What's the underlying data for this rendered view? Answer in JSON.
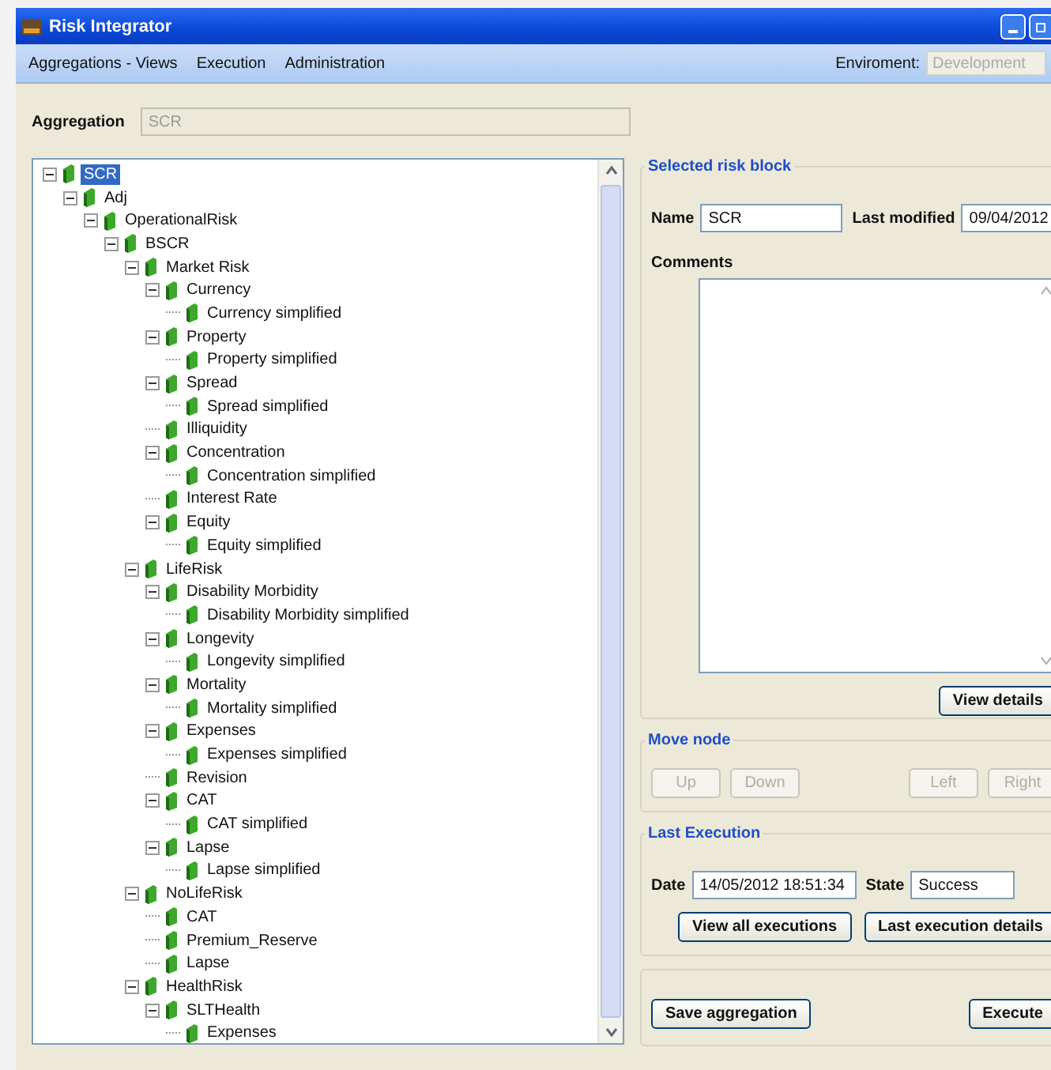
{
  "window": {
    "title": "Risk Integrator"
  },
  "menu": [
    "Aggregations - Views",
    "Execution",
    "Administration"
  ],
  "environment": {
    "label": "Enviroment:",
    "value": "Development",
    "disabled": true
  },
  "aggregation": {
    "label": "Aggregation",
    "value": "SCR",
    "disabled": true
  },
  "tree": [
    {
      "label": "SCR",
      "selected": true,
      "expanded": true,
      "children": [
        {
          "label": "Adj",
          "selected": false,
          "expanded": true,
          "children": [
            {
              "label": "OperationalRisk",
              "selected": false,
              "expanded": true,
              "children": [
                {
                  "label": "BSCR",
                  "selected": false,
                  "expanded": true,
                  "children": [
                    {
                      "label": "Market Risk",
                      "selected": false,
                      "expanded": true,
                      "children": [
                        {
                          "label": "Currency",
                          "selected": false,
                          "expanded": true,
                          "children": [
                            {
                              "label": "Currency simplified",
                              "selected": false
                            }
                          ]
                        },
                        {
                          "label": "Property",
                          "selected": false,
                          "expanded": true,
                          "children": [
                            {
                              "label": "Property simplified",
                              "selected": false
                            }
                          ]
                        },
                        {
                          "label": "Spread",
                          "selected": false,
                          "expanded": true,
                          "children": [
                            {
                              "label": "Spread simplified",
                              "selected": false
                            }
                          ]
                        },
                        {
                          "label": "Illiquidity",
                          "selected": false
                        },
                        {
                          "label": "Concentration",
                          "selected": false,
                          "expanded": true,
                          "children": [
                            {
                              "label": "Concentration simplified",
                              "selected": false
                            }
                          ]
                        },
                        {
                          "label": "Interest Rate",
                          "selected": false
                        },
                        {
                          "label": "Equity",
                          "selected": false,
                          "expanded": true,
                          "children": [
                            {
                              "label": "Equity simplified",
                              "selected": false
                            }
                          ]
                        }
                      ]
                    },
                    {
                      "label": "LifeRisk",
                      "selected": false,
                      "expanded": true,
                      "children": [
                        {
                          "label": "Disability Morbidity",
                          "selected": false,
                          "expanded": true,
                          "children": [
                            {
                              "label": "Disability Morbidity simplified",
                              "selected": false
                            }
                          ]
                        },
                        {
                          "label": "Longevity",
                          "selected": false,
                          "expanded": true,
                          "children": [
                            {
                              "label": "Longevity simplified",
                              "selected": false
                            }
                          ]
                        },
                        {
                          "label": "Mortality",
                          "selected": false,
                          "expanded": true,
                          "children": [
                            {
                              "label": "Mortality simplified",
                              "selected": false
                            }
                          ]
                        },
                        {
                          "label": "Expenses",
                          "selected": false,
                          "expanded": true,
                          "children": [
                            {
                              "label": "Expenses simplified",
                              "selected": false
                            }
                          ]
                        },
                        {
                          "label": "Revision",
                          "selected": false
                        },
                        {
                          "label": "CAT",
                          "selected": false,
                          "expanded": true,
                          "children": [
                            {
                              "label": "CAT simplified",
                              "selected": false
                            }
                          ]
                        },
                        {
                          "label": "Lapse",
                          "selected": false,
                          "expanded": true,
                          "children": [
                            {
                              "label": "Lapse simplified",
                              "selected": false
                            }
                          ]
                        }
                      ]
                    },
                    {
                      "label": "NoLifeRisk",
                      "selected": false,
                      "expanded": true,
                      "children": [
                        {
                          "label": "CAT",
                          "selected": false
                        },
                        {
                          "label": "Premium_Reserve",
                          "selected": false
                        },
                        {
                          "label": "Lapse",
                          "selected": false
                        }
                      ]
                    },
                    {
                      "label": "HealthRisk",
                      "selected": false,
                      "expanded": true,
                      "children": [
                        {
                          "label": "SLTHealth",
                          "selected": false,
                          "expanded": true,
                          "children": [
                            {
                              "label": "Expenses",
                              "selected": false
                            }
                          ]
                        }
                      ]
                    }
                  ]
                }
              ]
            }
          ]
        }
      ]
    }
  ],
  "selected_risk_block": {
    "title": "Selected risk block",
    "name_label": "Name",
    "name": "SCR",
    "modified_label": "Last modified",
    "modified": "09/04/2012",
    "comments_label": "Comments",
    "button": {
      "label": "View details",
      "disabled": false
    }
  },
  "move_node": {
    "title": "Move node",
    "buttons": [
      {
        "label": "Up",
        "disabled": true
      },
      {
        "label": "Down",
        "disabled": true
      },
      {
        "label": "Left",
        "disabled": true
      },
      {
        "label": "Right",
        "disabled": true
      }
    ]
  },
  "last_execution": {
    "title": "Last Execution",
    "date_label": "Date",
    "date": "14/05/2012 18:51:34",
    "state_label": "State",
    "state": "Success",
    "buttons": [
      {
        "label": "View all executions",
        "disabled": false
      },
      {
        "label": "Last execution details",
        "disabled": false
      }
    ]
  },
  "actions": [
    {
      "label": "Save aggregation",
      "disabled": false
    },
    {
      "label": "Execute",
      "disabled": false
    }
  ]
}
